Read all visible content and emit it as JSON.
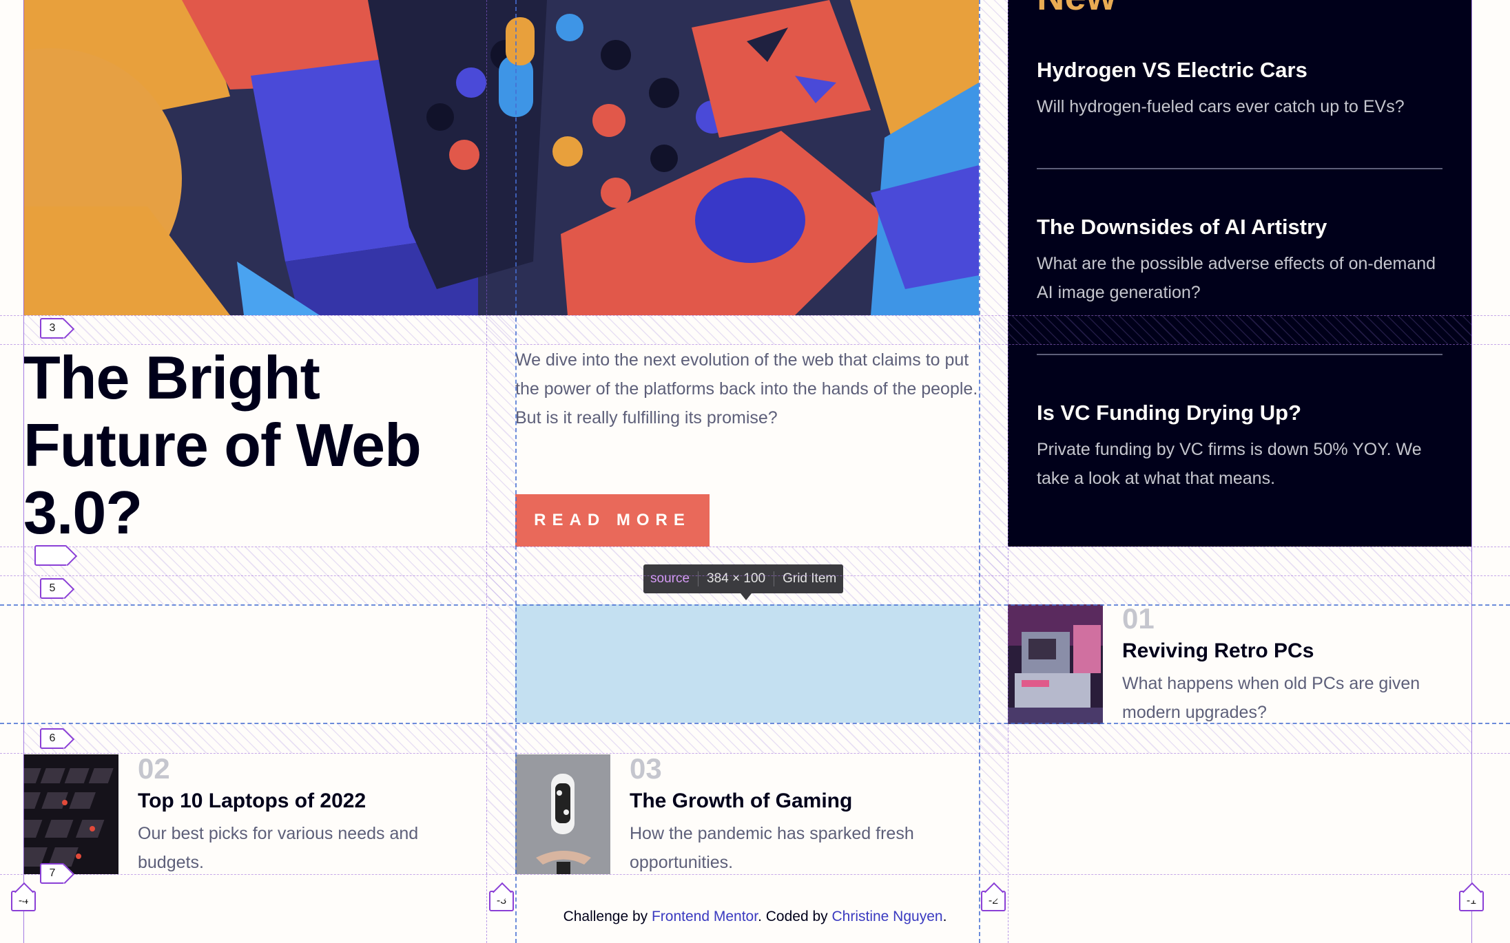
{
  "main": {
    "headline": "The Bright Future of Web 3.0?",
    "intro": "We dive into the next evolution of the web that claims to put the power of the platforms back into the hands of the people. But is it really fulfilling its promise?",
    "read_more": "READ MORE"
  },
  "new_panel": {
    "title": "New",
    "items": [
      {
        "title": "Hydrogen VS Electric Cars",
        "desc": "Will hydrogen-fueled cars ever catch up to EVs?"
      },
      {
        "title": "The Downsides of AI Artistry",
        "desc": "What are the possible adverse effects of on-demand AI image generation?"
      },
      {
        "title": "Is VC Funding Drying Up?",
        "desc": "Private funding by VC firms is down 50% YOY. We take a look at what that means."
      }
    ]
  },
  "articles": [
    {
      "num": "01",
      "title": "Reviving Retro PCs",
      "desc": "What happens when old PCs are given modern upgrades?"
    },
    {
      "num": "02",
      "title": "Top 10 Laptops of 2022",
      "desc": "Our best picks for various needs and budgets."
    },
    {
      "num": "03",
      "title": "The Growth of Gaming",
      "desc": "How the pandemic has sparked fresh opportunities."
    }
  ],
  "inspector": {
    "tag": "source",
    "dimensions": "384 × 100",
    "type": "Grid Item",
    "row_lines": [
      "3",
      "",
      "5",
      "6",
      "7"
    ],
    "col_lines": [
      "-4",
      "-3",
      "-2",
      "-1"
    ]
  },
  "footer": {
    "prefix": "Challenge by ",
    "link1": "Frontend Mentor",
    "middle": ". Coded by ",
    "link2": "Christine Nguyen",
    "suffix": "."
  },
  "colors": {
    "accent": "#e9695a",
    "new_title": "#e9ab53",
    "dark": "#00001a",
    "grid_line": "#8a3fd6",
    "selection": "#93c9ea"
  }
}
